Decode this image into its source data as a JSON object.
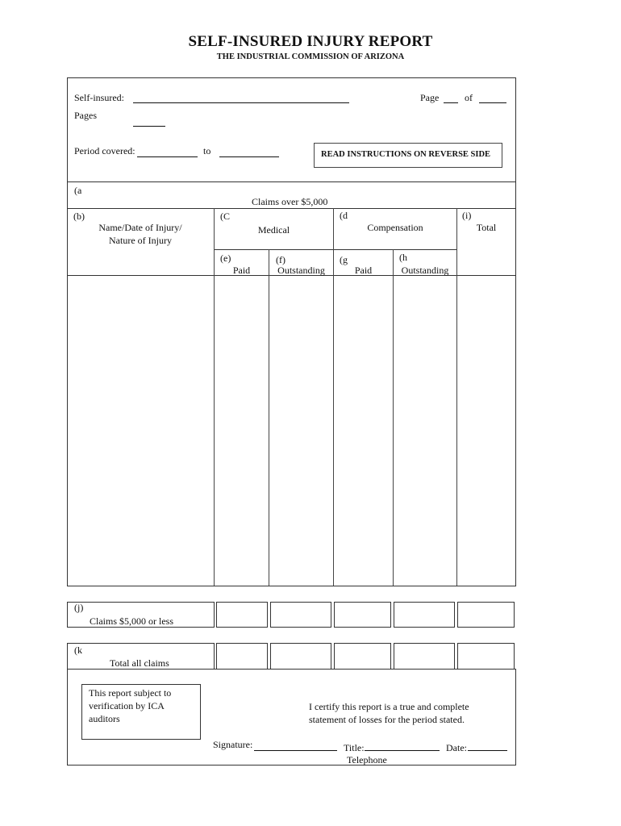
{
  "header": {
    "title": "SELF-INSURED INJURY REPORT",
    "subtitle": "THE INDUSTRIAL COMMISSION OF ARIZONA"
  },
  "top_section": {
    "self_insured_label": "Self-insured:",
    "self_insured_value": "",
    "pages_label": "Pages",
    "pages_value": "",
    "page_label": "Page",
    "page_value": "",
    "of_label": "of",
    "of_value": "",
    "period_covered_label": "Period covered:",
    "period_from_value": "",
    "to_label": "to",
    "period_to_value": "",
    "instructions_notice": "READ INSTRUCTIONS ON REVERSE SIDE"
  },
  "table": {
    "section_a_marker": "(a",
    "section_a_title": "Claims over $5,000",
    "col_b_marker": "(b)",
    "col_b_line1": "Name/Date of Injury/",
    "col_b_line2": "Nature of Injury",
    "col_c_marker": "(C",
    "col_c_label": "Medical",
    "col_d_marker": "(d",
    "col_d_label": "Compensation",
    "col_i_marker": "(i)",
    "col_i_label": "Total",
    "col_e_marker": "(e)",
    "col_e_label": "Paid",
    "col_f_marker": "(f)",
    "col_f_label": "Outstanding",
    "col_g_marker": "(g",
    "col_g_label": "Paid",
    "col_h_marker": "(h",
    "col_h_label": "Outstanding"
  },
  "summary_rows": [
    {
      "marker": "(j)",
      "label": "Claims $5,000 or less",
      "values": [
        "",
        "",
        "",
        "",
        ""
      ]
    },
    {
      "marker": "(k",
      "label": "Total all claims",
      "values": [
        "",
        "",
        "",
        "",
        ""
      ]
    }
  ],
  "footer": {
    "verification_note": "This report subject to verification by ICA auditors",
    "certify_line1": "I certify this report is a true and complete",
    "certify_line2": "statement of losses for the period stated.",
    "signature_label": "Signature:",
    "title_label": "Title:",
    "date_label": "Date:",
    "telephone_label": "Telephone"
  }
}
